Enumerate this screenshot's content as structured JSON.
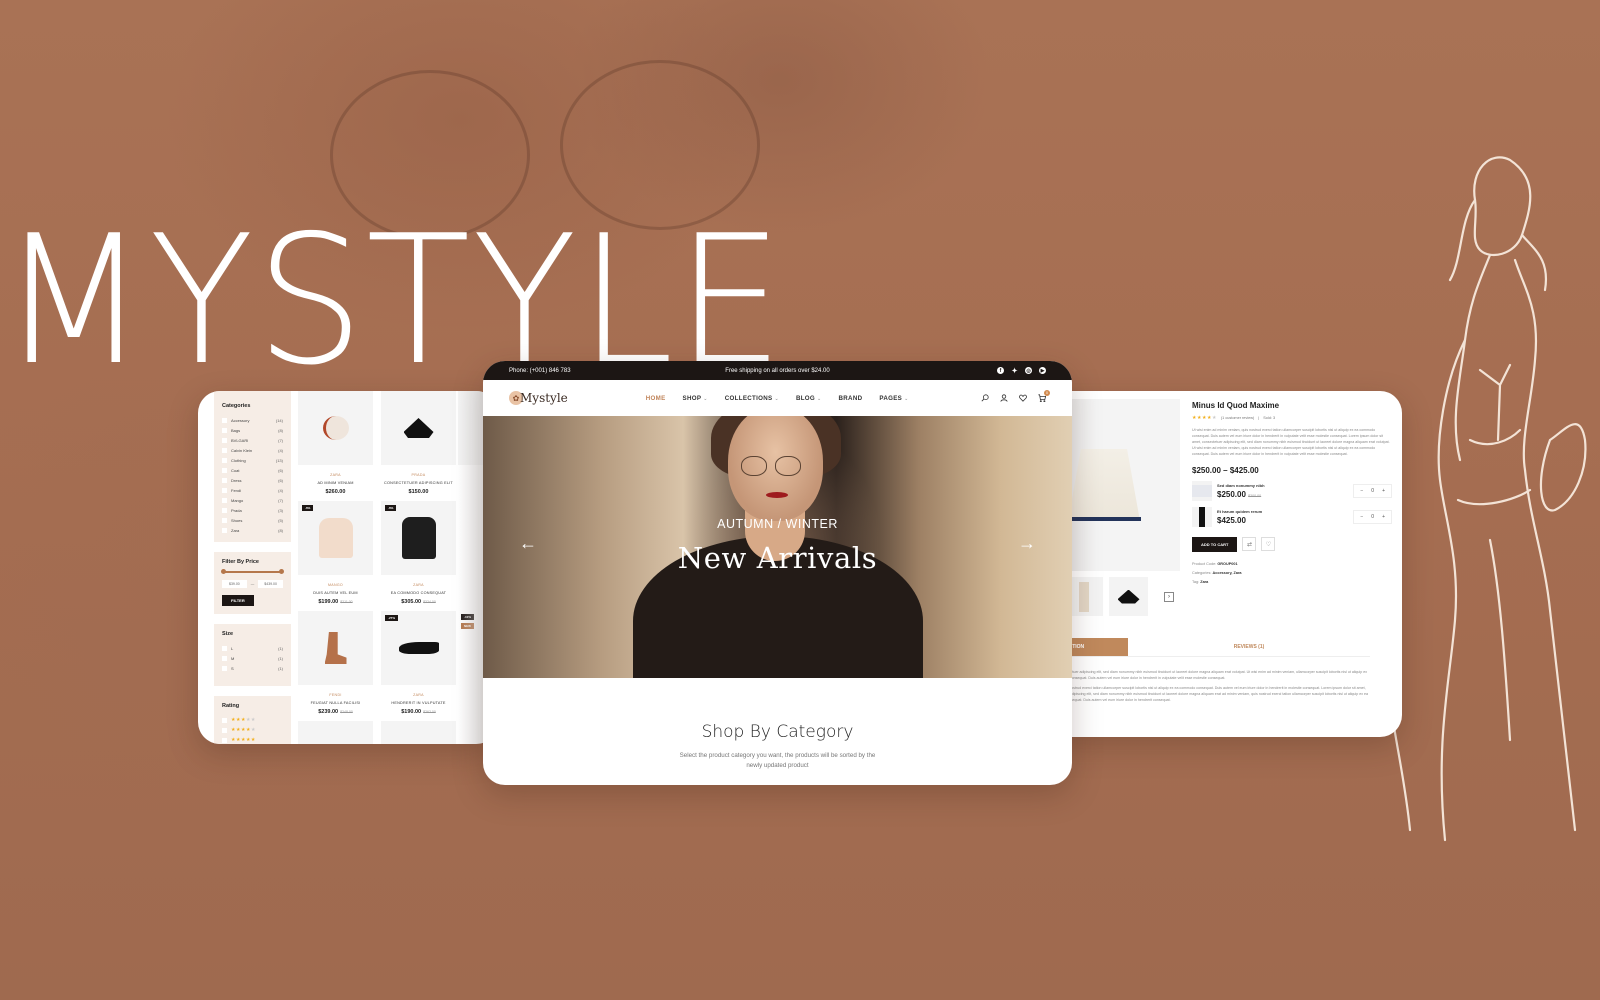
{
  "banner": {
    "title": "MYSTYLE"
  },
  "storefront": {
    "topbar": {
      "phone": "Phone: (+001) 846 783",
      "shipping": "Free shipping on all orders over $24.00",
      "social_icons": [
        "facebook-icon",
        "twitter-icon",
        "instagram-icon",
        "youtube-icon"
      ]
    },
    "logo": "Mystyle",
    "nav": [
      {
        "label": "HOME",
        "dropdown": false,
        "active": true
      },
      {
        "label": "SHOP",
        "dropdown": true
      },
      {
        "label": "COLLECTIONS",
        "dropdown": true
      },
      {
        "label": "BLOG",
        "dropdown": true
      },
      {
        "label": "BRAND",
        "dropdown": false
      },
      {
        "label": "PAGES",
        "dropdown": true
      }
    ],
    "cart_count": "0",
    "hero": {
      "subtitle": "AUTUMN / WINTER",
      "heading": "New Arrivals"
    },
    "section": {
      "title": "Shop By Category",
      "description": "Select the product category you want, the products will be sorted by the newly updated product"
    }
  },
  "shop_page": {
    "categories": {
      "title": "Categories",
      "items": [
        {
          "name": "Accessory",
          "count": "(14)"
        },
        {
          "name": "Bags",
          "count": "(8)"
        },
        {
          "name": "BVLGARI",
          "count": "(7)"
        },
        {
          "name": "Calvin Klein",
          "count": "(4)"
        },
        {
          "name": "Clothing",
          "count": "(13)"
        },
        {
          "name": "Coat",
          "count": "(6)"
        },
        {
          "name": "Dress",
          "count": "(6)"
        },
        {
          "name": "Fendi",
          "count": "(4)"
        },
        {
          "name": "Mango",
          "count": "(7)"
        },
        {
          "name": "Prada",
          "count": "(3)"
        },
        {
          "name": "Shoes",
          "count": "(5)"
        },
        {
          "name": "Zara",
          "count": "(8)"
        }
      ]
    },
    "price_filter": {
      "title": "Filter By Price",
      "min": "$39.00",
      "max": "$439.00",
      "button": "FILTER"
    },
    "size": {
      "title": "Size",
      "items": [
        {
          "name": "L",
          "count": "(1)"
        },
        {
          "name": "M",
          "count": "(1)"
        },
        {
          "name": "S",
          "count": "(1)"
        }
      ]
    },
    "rating": {
      "title": "Rating",
      "items": [
        3,
        4,
        5
      ]
    },
    "products": [
      {
        "brand": "ZARA",
        "name": "AD MINIM VENIAM",
        "price": "$260.00",
        "old": "",
        "badge": ""
      },
      {
        "brand": "PRADA",
        "name": "CONSECTETUER ADIPISCING ELIT",
        "price": "$150.00",
        "old": "",
        "badge": ""
      },
      {
        "brand": "MANGO",
        "name": "DUIS AUTEM VEL EUM",
        "price": "$199.00",
        "old": "$211.00",
        "badge": "-6%"
      },
      {
        "brand": "ZARA",
        "name": "EA COMMODO CONSEQUAT",
        "price": "$305.00",
        "old": "$324.00",
        "badge": "-6%"
      },
      {
        "brand": "FENDI",
        "name": "FEUGIAT NULLA FACILISI",
        "price": "$239.00",
        "old": "$248.00",
        "badge": ""
      },
      {
        "brand": "ZARA",
        "name": "HENDRERIT IN VULPUTATE",
        "price": "$190.00",
        "old": "$262.00",
        "badge": "-27%"
      }
    ],
    "partial_badges": [
      "-10%",
      "NEW"
    ]
  },
  "product_page": {
    "title": "Minus Id Quod Maxime",
    "rating": 4,
    "reviews": "(1 customer review)",
    "sold": "Sold: 3",
    "description": "Ut wisi enim ad minim veniam, quis nostrud exerci tation ullamcorper suscipit lobortis nisl ut aliquip ex ea commodo consequat. Duis autem vel eum iriure dolor in hendrerit in vulputate velit esse molestie consequat. Lorem ipsum dolor sit amet, consectetuer adipiscing elit, sed diam nonummy nibh euismod tincidunt ut laoreet dolore magna aliquam erat volutpat. Ut wisi enim ad minim veniam, quis nostrud exerci tation ullamcorper suscipit lobortis nisl ut aliquip ex ea commodo consequat. Duis autem vel eum iriure dolor in hendrerit in vulputate velit esse molestie consequat.",
    "price_range": "$250.00 – $425.00",
    "group_items": [
      {
        "name": "Sed diam nonummy nibh",
        "price": "$250.00",
        "old": "$300.00",
        "qty": "0"
      },
      {
        "name": "Et harum quidem rerum",
        "price": "$425.00",
        "old": "",
        "qty": "0"
      }
    ],
    "add_to_cart": "ADD TO CART",
    "product_code_label": "Product Code:",
    "product_code": "GROUP001",
    "categories_label": "Categories:",
    "categories": "Accessory, Zara",
    "tag_label": "Tag:",
    "tag": "Zara",
    "tabs": [
      "DESCRIPTION",
      "REVIEWS (1)"
    ],
    "tab_text": [
      "amet, consectetuer adipiscing elit, sed diam nonummy nibh euismod tincidunt ut laoreet dolore magna aliquam erat volutpat. Ut wisi enim ad minim veniam, ullamcorper suscipit lobortis nisl ut aliquip ex ea commodo consequat. Duis autem vel eum iriure dolor in hendrerit in vulputate velit esse molestie consequat.",
      "veniam, quis nostrud exerci tation ullamcorper suscipit lobortis nisl ut aliquip ex ea commodo consequat. Duis autem vel eum iriure dolor in hendrerit in molestie consequat. Lorem ipsum dolor sit amet, consectetuer adipiscing elit, sed diam nonummy nibh euismod tincidunt ut laoreet dolore magna aliquam erat ad minim veniam, quis nostrud exerci tation ullamcorper suscipit lobortis nisl ut aliquip ex ea commodo consequat. Duis autem vel eum iriure dolor in hendrerit consequat."
    ]
  },
  "colors": {
    "background": "#a86f52",
    "accent": "#c0845a",
    "dark": "#1c1614",
    "sidebar_bg": "#f6ede6",
    "star": "#f2b01e"
  }
}
